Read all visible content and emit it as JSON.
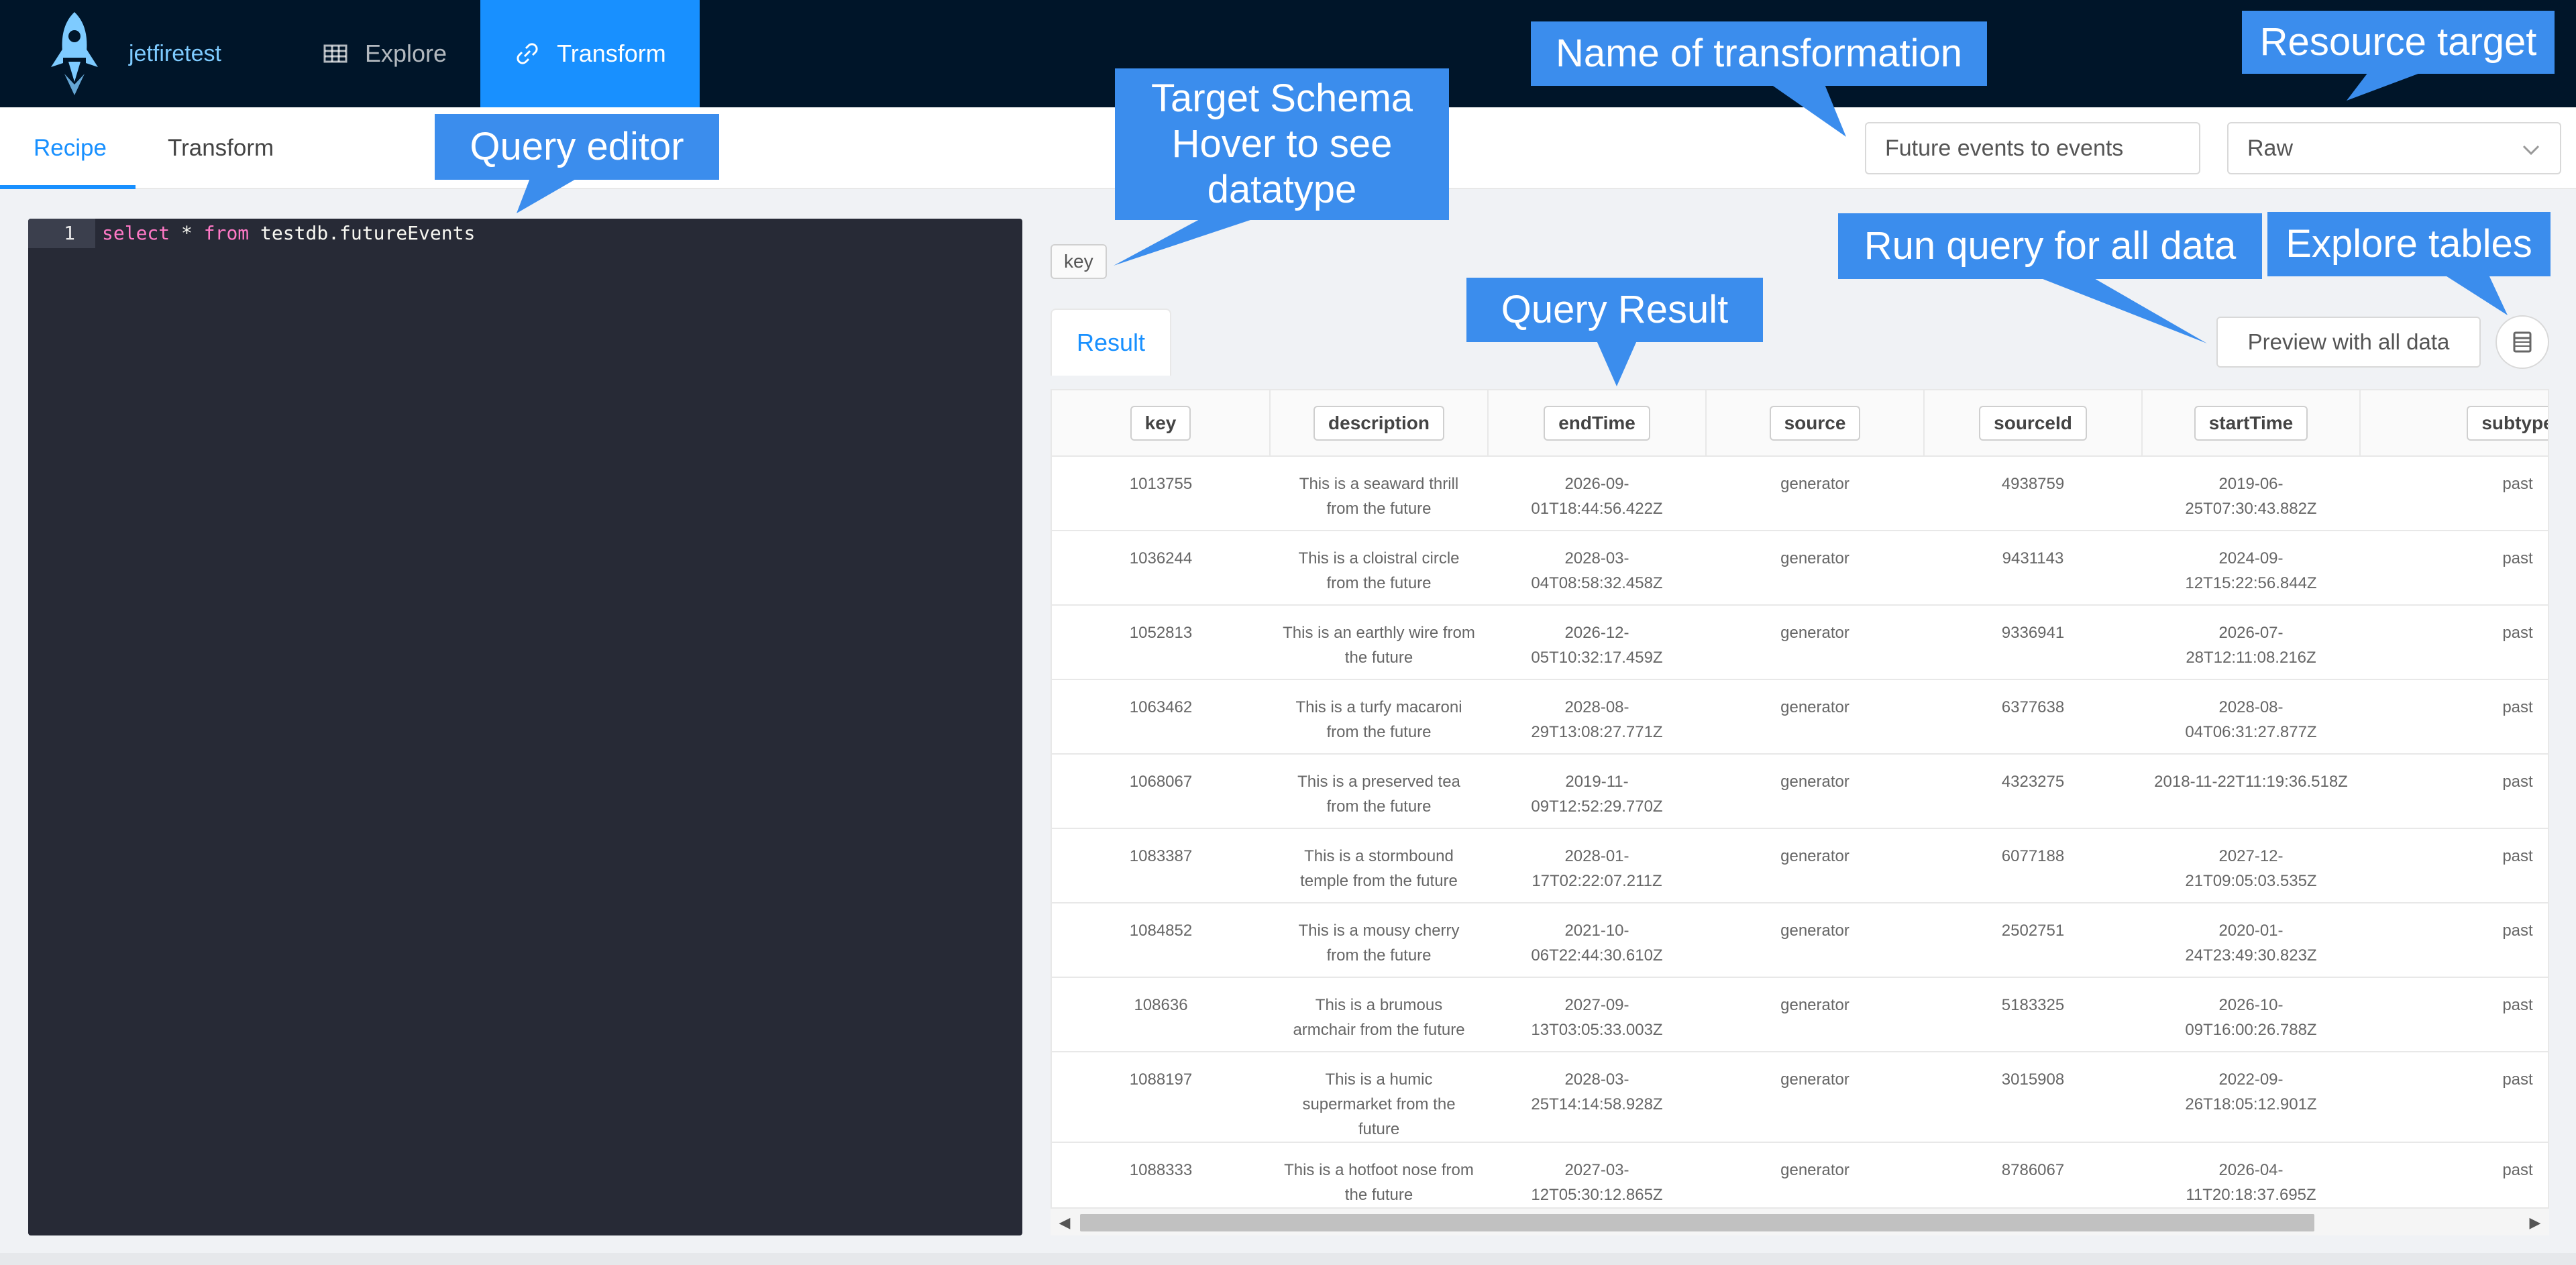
{
  "nav": {
    "brand": "jetfiretest",
    "items": [
      {
        "label": "Explore"
      },
      {
        "label": "Transform"
      }
    ]
  },
  "subtabs": [
    "Recipe",
    "Transform"
  ],
  "transform_name": {
    "value": "Future events to events"
  },
  "resource_target": {
    "value": "Raw"
  },
  "editor": {
    "line": "1",
    "kw1": "select",
    "mid": " * ",
    "kw2": "from",
    "rest": " testdb.futureEvents"
  },
  "schema_key": "key",
  "result_tab": "Result",
  "preview_button": "Preview with all data",
  "table": {
    "columns": [
      "key",
      "description",
      "endTime",
      "source",
      "sourceId",
      "startTime",
      "subtype"
    ],
    "rows": [
      [
        "1013755",
        "This is a seaward thrill from the future",
        "2026-09-01T18:44:56.422Z",
        "generator",
        "4938759",
        "2019-06-25T07:30:43.882Z",
        "past"
      ],
      [
        "1036244",
        "This is a cloistral circle from the future",
        "2028-03-04T08:58:32.458Z",
        "generator",
        "9431143",
        "2024-09-12T15:22:56.844Z",
        "past"
      ],
      [
        "1052813",
        "This is an earthly wire from the future",
        "2026-12-05T10:32:17.459Z",
        "generator",
        "9336941",
        "2026-07-28T12:11:08.216Z",
        "past"
      ],
      [
        "1063462",
        "This is a turfy macaroni from the future",
        "2028-08-29T13:08:27.771Z",
        "generator",
        "6377638",
        "2028-08-04T06:31:27.877Z",
        "past"
      ],
      [
        "1068067",
        "This is a preserved tea from the future",
        "2019-11-09T12:52:29.770Z",
        "generator",
        "4323275",
        "2018-11-22T11:19:36.518Z",
        "past"
      ],
      [
        "1083387",
        "This is a stormbound temple from the future",
        "2028-01-17T02:22:07.211Z",
        "generator",
        "6077188",
        "2027-12-21T09:05:03.535Z",
        "past"
      ],
      [
        "1084852",
        "This is a mousy cherry from the future",
        "2021-10-06T22:44:30.610Z",
        "generator",
        "2502751",
        "2020-01-24T23:49:30.823Z",
        "past"
      ],
      [
        "108636",
        "This is a brumous armchair from the future",
        "2027-09-13T03:05:33.003Z",
        "generator",
        "5183325",
        "2026-10-09T16:00:26.788Z",
        "past"
      ],
      [
        "1088197",
        "This is a humic supermarket from the future",
        "2028-03-25T14:14:58.928Z",
        "generator",
        "3015908",
        "2022-09-26T18:05:12.901Z",
        "past"
      ],
      [
        "1088333",
        "This is a hotfoot nose from the future",
        "2027-03-12T05:30:12.865Z",
        "generator",
        "8786067",
        "2026-04-11T20:18:37.695Z",
        "past"
      ]
    ]
  },
  "callouts": {
    "query_editor": "Query editor",
    "target_schema": [
      "Target Schema",
      "Hover to see",
      "datatype"
    ],
    "name_of_transformation": "Name of transformation",
    "resource_target": "Resource target",
    "run_query": "Run query for all data",
    "explore_tables": "Explore tables",
    "query_result": "Query Result"
  },
  "colors": {
    "nav_bg": "#001529",
    "accent": "#1890ff",
    "callout": "#3b8ded",
    "editor_bg": "#272a36"
  },
  "icons": {
    "brand": "rocket-icon",
    "explore": "table-grid-icon",
    "transform": "link-icon",
    "select": "chevron-down-icon",
    "tables": "database-table-icon"
  }
}
